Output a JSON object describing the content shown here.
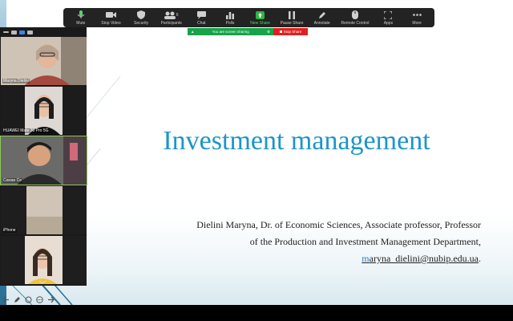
{
  "toolbar": {
    "items": [
      {
        "label": "Mute",
        "icon": "microphone-icon"
      },
      {
        "label": "Stop Video",
        "icon": "video-camera-icon"
      },
      {
        "label": "Security",
        "icon": "shield-icon"
      },
      {
        "label": "Participants",
        "icon": "participants-icon",
        "count": "6"
      },
      {
        "label": "Chat",
        "icon": "chat-bubble-icon"
      },
      {
        "label": "Polls",
        "icon": "bar-chart-icon"
      },
      {
        "label": "New Share",
        "icon": "share-up-arrow-icon"
      },
      {
        "label": "Pause Share",
        "icon": "pause-icon"
      },
      {
        "label": "Annotate",
        "icon": "pencil-icon"
      },
      {
        "label": "Remote Control",
        "icon": "mouse-icon"
      },
      {
        "label": "Apps",
        "icon": "apps-icon"
      },
      {
        "label": "More",
        "icon": "more-dots-icon"
      }
    ]
  },
  "share_banner": {
    "status_text": "You are screen sharing",
    "stop_label": "Stop Share"
  },
  "video_panel": {
    "tiles": [
      {
        "name": "Maryna Dielini"
      },
      {
        "name": "HUAWEI Mate 30 Pro 5G"
      },
      {
        "name": "Сюхан Се"
      },
      {
        "name": "iPhone"
      },
      {
        "name": ""
      }
    ]
  },
  "slide": {
    "title": "Investment management",
    "author_line1": "Dielini Maryna, Dr. of Economic Sciences, Associate professor, Professor",
    "author_line2": "of the Production and Investment Management Department,",
    "email_first": "m",
    "email_rest": "aryna_dielini@nubip.edu.ua",
    "email_suffix": "."
  },
  "colors": {
    "title": "#1c95c8",
    "toolbar_bg": "#232323",
    "share_green": "#16a34a",
    "stop_red": "#e02020",
    "active_tile_border": "#8acb55"
  }
}
